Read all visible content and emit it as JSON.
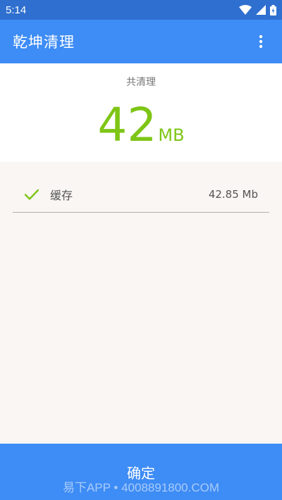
{
  "status_bar": {
    "time": "5:14"
  },
  "app_bar": {
    "title": "乾坤清理",
    "menu_icon": "more-vert-icon"
  },
  "summary": {
    "label": "共清理",
    "amount": "42",
    "unit": "MB"
  },
  "items": [
    {
      "name": "缓存",
      "size": "42.85 Mb",
      "icon": "check-icon"
    }
  ],
  "footer": {
    "confirm_label": "确定",
    "watermark": "易下APP • 4008891800.COM"
  },
  "colors": {
    "primary": "#3e8cf5",
    "status_bar": "#2f6fcf",
    "accent_green": "#7ec516",
    "list_background": "#f9f6f4"
  }
}
